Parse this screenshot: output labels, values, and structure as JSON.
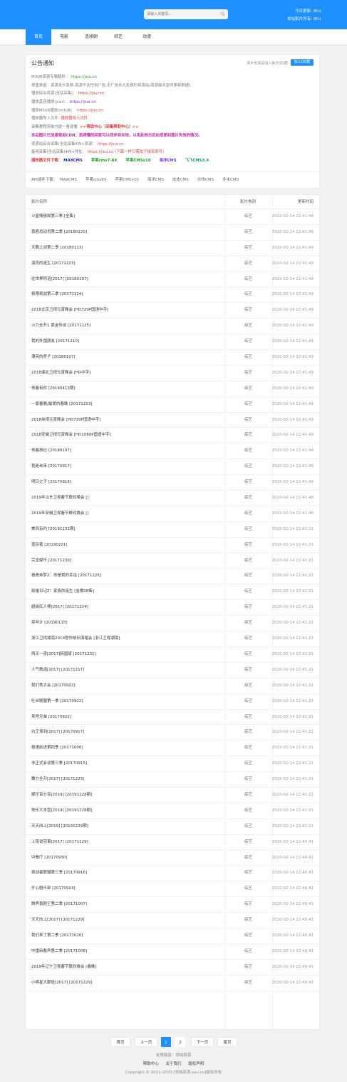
{
  "header": {
    "search_placeholder": "请输入关键词...",
    "stats": [
      {
        "label": "今日更新:",
        "value": "80+"
      },
      {
        "label": "本站影片共有:",
        "value": "80+"
      }
    ]
  },
  "nav": {
    "items": [
      "首页",
      "电影",
      "连续剧",
      "综艺",
      "动漫"
    ],
    "active": 0
  },
  "notice": {
    "title": "公告通知",
    "qq_hint": "求片反馈请加入官方QQ群",
    "qq_button": "加入QQ群",
    "lines": [
      [
        {
          "t": "M3U8资源专属解析："
        },
        {
          "t": "https://jsui.cn",
          "c": "c-green"
        }
      ],
      [
        {
          "t": "郑重承诺：资源永久免费,资源不含任何广告,无广告永久免费的资源站(资源每天定时更新数据)"
        }
      ],
      [
        {
          "t": "播放综合资源(全站采集)："
        },
        {
          "t": "https://jsui.cn",
          "c": "c-red"
        }
      ],
      [
        {
          "t": "播放直连播放(yun)："
        },
        {
          "t": "https://jsui.cn",
          "c": "c-purple"
        }
      ],
      [
        {
          "t": "播放M3U8播放(m3u8)："
        },
        {
          "t": "https://jsui.cn",
          "c": "c-red"
        }
      ],
      [
        {
          "t": "播放器导入文件 "
        },
        {
          "t": "播放器导入文件",
          "c": "c-red"
        }
      ],
      [
        {
          "t": "采集教程简单方便一看就懂 "
        },
        {
          "t": "✔✔帮助中心（采集帮助中心）✔✔",
          "c": "c-red c-bold"
        }
      ],
      [
        {
          "t": "本站图片已加速使用CDN，您得懂的回家可以同步到本地，以免赴他日后出现更利图片失效的情况。",
          "c": "c-mag c-bold"
        }
      ],
      [
        {
          "t": "资源站综合采集(全站采集4W+资源："
        },
        {
          "t": "https://jsui.cn",
          "c": "c-red"
        }
      ],
      [
        {
          "t": "备用采集(全站采集)4W+地址："
        },
        {
          "t": "https://jsui.cn (下面一样只需改下域名即可)",
          "c": "c-red"
        }
      ],
      [
        {
          "t": "播放器文件下载：",
          "c": "c-red c-bold"
        },
        {
          "t": "MAXCMS",
          "c": "c-blue c-bold"
        },
        {
          "t": "苹果cms7-8X",
          "c": "c-green c-bold"
        },
        {
          "t": "苹果CMSv10",
          "c": "c-green c-bold"
        },
        {
          "t": "海洋CMS",
          "c": "c-purple c-bold"
        },
        {
          "t": "飞飞CMS3.4",
          "c": "c-teal c-bold"
        }
      ]
    ],
    "api_label": "API插件下载：",
    "api_links": [
      "MAXCMS",
      "苹果cms8X",
      "苹果CMSv10",
      "海洋CMS",
      "皮皮CMS",
      "光线CMS",
      "多米CMS"
    ]
  },
  "table": {
    "headers": [
      "影片名称",
      "影片类别",
      "更新时间"
    ],
    "rows": [
      [
        "火星情报局第三季 [全集]",
        "综艺",
        "2020-02-14 22:41:49"
      ],
      [
        "喜剧总动员第二季 [20180120]",
        "综艺",
        "2020-02-14 22:41:49"
      ],
      [
        "天籁之战第二季 [20180113]",
        "综艺",
        "2020-02-14 22:41:49"
      ],
      [
        "演员的诞生 [20171223]",
        "综艺",
        "2020-02-14 22:41:49"
      ],
      [
        "往世界称道[2017] [20180107]",
        "综艺",
        "2020-02-14 22:41:49"
      ],
      [
        "极限挑战第三季 [20171124]",
        "综艺",
        "2020-02-14 22:41:49"
      ],
      [
        "2018北京卫视元宵晚会 [HD720P国语中字]",
        "综艺",
        "2020-02-14 22:41:49"
      ],
      [
        "火力全开1 黄金传说 [20171125]",
        "综艺",
        "2020-02-14 22:41:49"
      ],
      [
        "我的外国朋友 [20171210]",
        "综艺",
        "2020-02-14 22:41:49"
      ],
      [
        "漂亮的房子 [20180107]",
        "综艺",
        "2020-02-14 22:41:49"
      ],
      [
        "2018湖北卫视元宵晚会 [HD中字]",
        "综艺",
        "2020-02-14 22:41:49"
      ],
      [
        "青春有你 [20190413期]",
        "综艺",
        "2020-02-14 22:41:49"
      ],
      [
        "一家春晚/最爱的春晚 [20171223]",
        "综艺",
        "2020-02-14 22:41:49"
      ],
      [
        "2018央视元宵晚会 [HD720P国语中字]",
        "综艺",
        "2020-02-14 22:41:49"
      ],
      [
        "2018安徽卫视元宵晚会 [HD1080P国语中字]",
        "综艺",
        "2020-02-14 22:41:49"
      ],
      [
        "青春旅社 [20180107]",
        "综艺",
        "2020-02-14 22:41:49"
      ],
      [
        "我是未来 [20170917]",
        "综艺",
        "2020-02-14 22:41:49"
      ],
      [
        "明日之子 [20170916]",
        "综艺",
        "2020-02-14 22:41:49"
      ],
      [
        "2019年山东卫视春节联欢晚会 []",
        "综艺",
        "2020-02-14 22:41:48"
      ],
      [
        "2019年安徽卫视春节联欢晚会 []",
        "综艺",
        "2020-02-14 22:41:48"
      ],
      [
        "美风有约 [20191231期]",
        "综艺",
        "2020-02-14 22:41:21"
      ],
      [
        "盖玩者 [20190221]",
        "综艺",
        "2020-02-14 22:41:21"
      ],
      [
        "完全娱乐 [20171230]",
        "综艺",
        "2020-02-14 22:41:21"
      ],
      [
        "爸爸奔梦2：你是我的幸运 [20171225]",
        "综艺",
        "2020-02-14 22:41:21"
      ],
      [
        "新婚日记2：家族的诞生 [金歌08集]",
        "综艺",
        "2020-02-14 22:41:21"
      ],
      [
        "超级红人榜[2017] [20171224]",
        "综艺",
        "2020-02-14 22:41:21"
      ],
      [
        "卖叫计 [20190115]",
        "综艺",
        "2020-02-14 22:41:21"
      ],
      [
        "浙江卫视湖南2019誓你依旧演唱会 [浙江卫视湖南]",
        "综艺",
        "2020-02-14 22:41:21"
      ],
      [
        "两天一夜[2017]韩国版 [20171231]",
        "综艺",
        "2020-02-14 22:41:21"
      ],
      [
        "人气歌谣[2017] [20171217]",
        "综艺",
        "2020-02-14 22:41:21"
      ],
      [
        "我们秀大会 [20170922]",
        "综艺",
        "2020-02-14 22:41:21"
      ],
      [
        "吐丝联盟第一季 [20170922]",
        "综艺",
        "2020-02-14 22:41:21"
      ],
      [
        "来吧兄弟 [20170922]",
        "综艺",
        "2020-02-14 22:41:21"
      ],
      [
        "坑王驾到[2017] [20170917]",
        "综艺",
        "2020-02-14 22:41:21"
      ],
      [
        "极速前进第四季 [20171006]",
        "综艺",
        "2020-02-14 22:41:21"
      ],
      [
        "非正式会谈第三季 [20170915]",
        "综艺",
        "2020-02-14 22:41:21"
      ],
      [
        "舞力全开[2017] [20171223]",
        "综艺",
        "2020-02-14 22:41:21"
      ],
      [
        "娱乐百分百[2019] [20191228期]",
        "综艺",
        "2020-02-14 22:41:21"
      ],
      [
        "快乐大本营[2019] [20191228期]",
        "综艺",
        "2020-02-14 22:41:21"
      ],
      [
        "天天向上[2019] [20191229期]",
        "综艺",
        "2020-02-14 22:41:21"
      ],
      [
        "上阳说完事[2017] [20171229]",
        "综艺",
        "2020-02-14 22:40:41"
      ],
      [
        "中餐厅 [20170930]",
        "综艺",
        "2020-02-14 22:40:41"
      ],
      [
        "挑战者联盟第三季 [20170916]",
        "综艺",
        "2020-02-14 22:40:41"
      ],
      [
        "开心剧乐部 [20170923]",
        "综艺",
        "2020-02-14 22:40:41"
      ],
      [
        "跨界喜剧王第二季 [20171007]",
        "综艺",
        "2020-02-14 22:40:41"
      ],
      [
        "天天向上[2017] [20171229]",
        "综艺",
        "2020-02-14 22:40:41"
      ],
      [
        "我们来了第二季 [20171020]",
        "综艺",
        "2020-02-14 22:40:41"
      ],
      [
        "中国新歌声第二季 [20171008]",
        "综艺",
        "2020-02-14 22:40:41"
      ],
      [
        "2019年辽宁卫视春节联欢晚会 [春晚]",
        "综艺",
        "2020-02-14 22:40:41"
      ],
      [
        "小明星大跟班[2017] [20171229]",
        "综艺",
        "2020-02-14 22:40:41"
      ]
    ]
  },
  "pager": {
    "first": "首页",
    "prev": "上一页",
    "pages": [
      "1",
      "2"
    ],
    "active_page": 0,
    "next": "下一页",
    "last": "尾页"
  },
  "footer": {
    "friend_links": "友情链接：领域资源",
    "links": [
      "帮助中心",
      "关于我们",
      "版权声明"
    ],
    "copyright": "Copyright © 2011-2020 [领域资源-jsui.cn]版权所有"
  }
}
